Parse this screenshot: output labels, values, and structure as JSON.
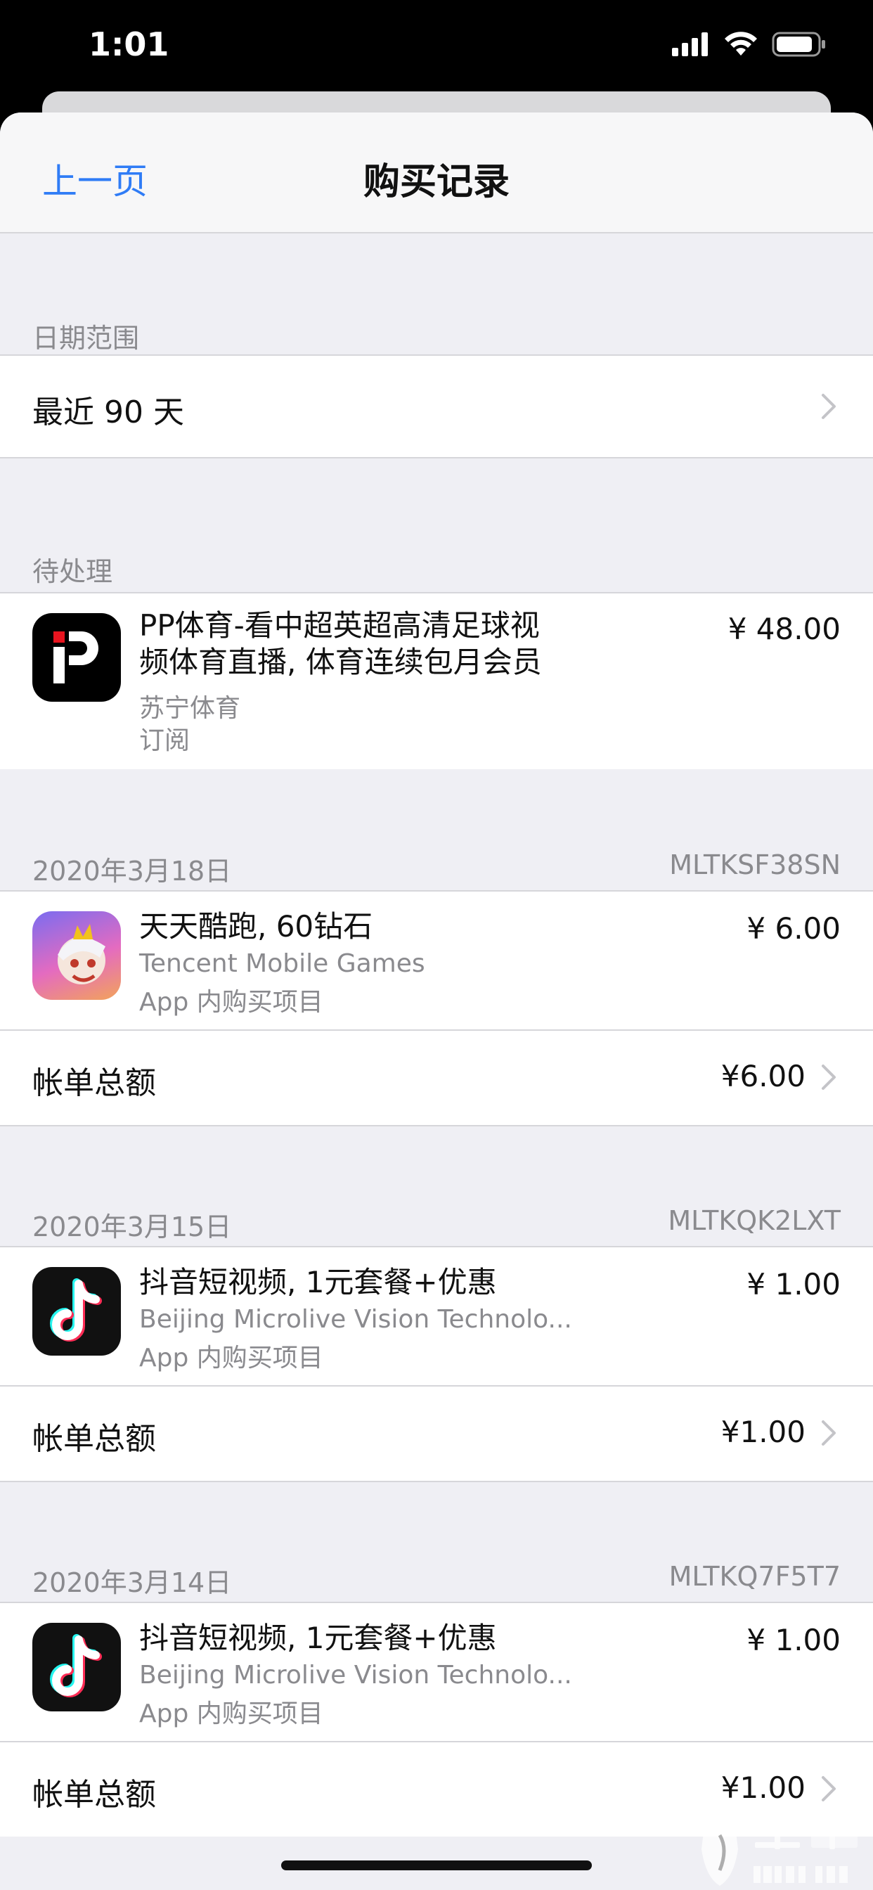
{
  "status": {
    "time": "1:01"
  },
  "nav": {
    "back_label": "上一页",
    "title": "购买记录"
  },
  "date_range": {
    "header": "日期范围",
    "value": "最近 90 天"
  },
  "pending": {
    "header": "待处理",
    "item": {
      "title_line1": "PP体育-看中超英超高清足球视",
      "title_line2": "频体育直播, 体育连续包月会员",
      "developer": "苏宁体育",
      "kind": "订阅",
      "price": "¥ 48.00"
    }
  },
  "orders": [
    {
      "date": "2020年3月18日",
      "order_id": "MLTKSF38SN",
      "title": "天天酷跑, 60钻石",
      "developer": "Tencent Mobile Games",
      "kind": "App 内购买项目",
      "price": "¥ 6.00",
      "total_label": "帐单总额",
      "total": "¥6.00"
    },
    {
      "date": "2020年3月15日",
      "order_id": "MLTKQK2LXT",
      "title": "抖音短视频, 1元套餐+优惠",
      "developer": "Beijing Microlive Vision Technolo...",
      "kind": "App 内购买项目",
      "price": "¥ 1.00",
      "total_label": "帐单总额",
      "total": "¥1.00"
    },
    {
      "date": "2020年3月14日",
      "order_id": "MLTKQ7F5T7",
      "title": "抖音短视频, 1元套餐+优惠",
      "developer": "Beijing Microlive Vision Technolo...",
      "kind": "App 内购买项目",
      "price": "¥ 1.00",
      "total_label": "帐单总额",
      "total": "¥1.00"
    }
  ],
  "watermark": {
    "text_cn": "黑猫",
    "text_en": "BLACK CAT"
  },
  "colors": {
    "accent": "#2f7cf6",
    "background": "#efeff4",
    "secondary_text": "#8a8a8e"
  },
  "icons": [
    "signal-icon",
    "wifi-icon",
    "battery-icon",
    "chevron-right-icon",
    "pp-sports-app-icon",
    "tiantian-kupao-app-icon",
    "douyin-app-icon"
  ]
}
